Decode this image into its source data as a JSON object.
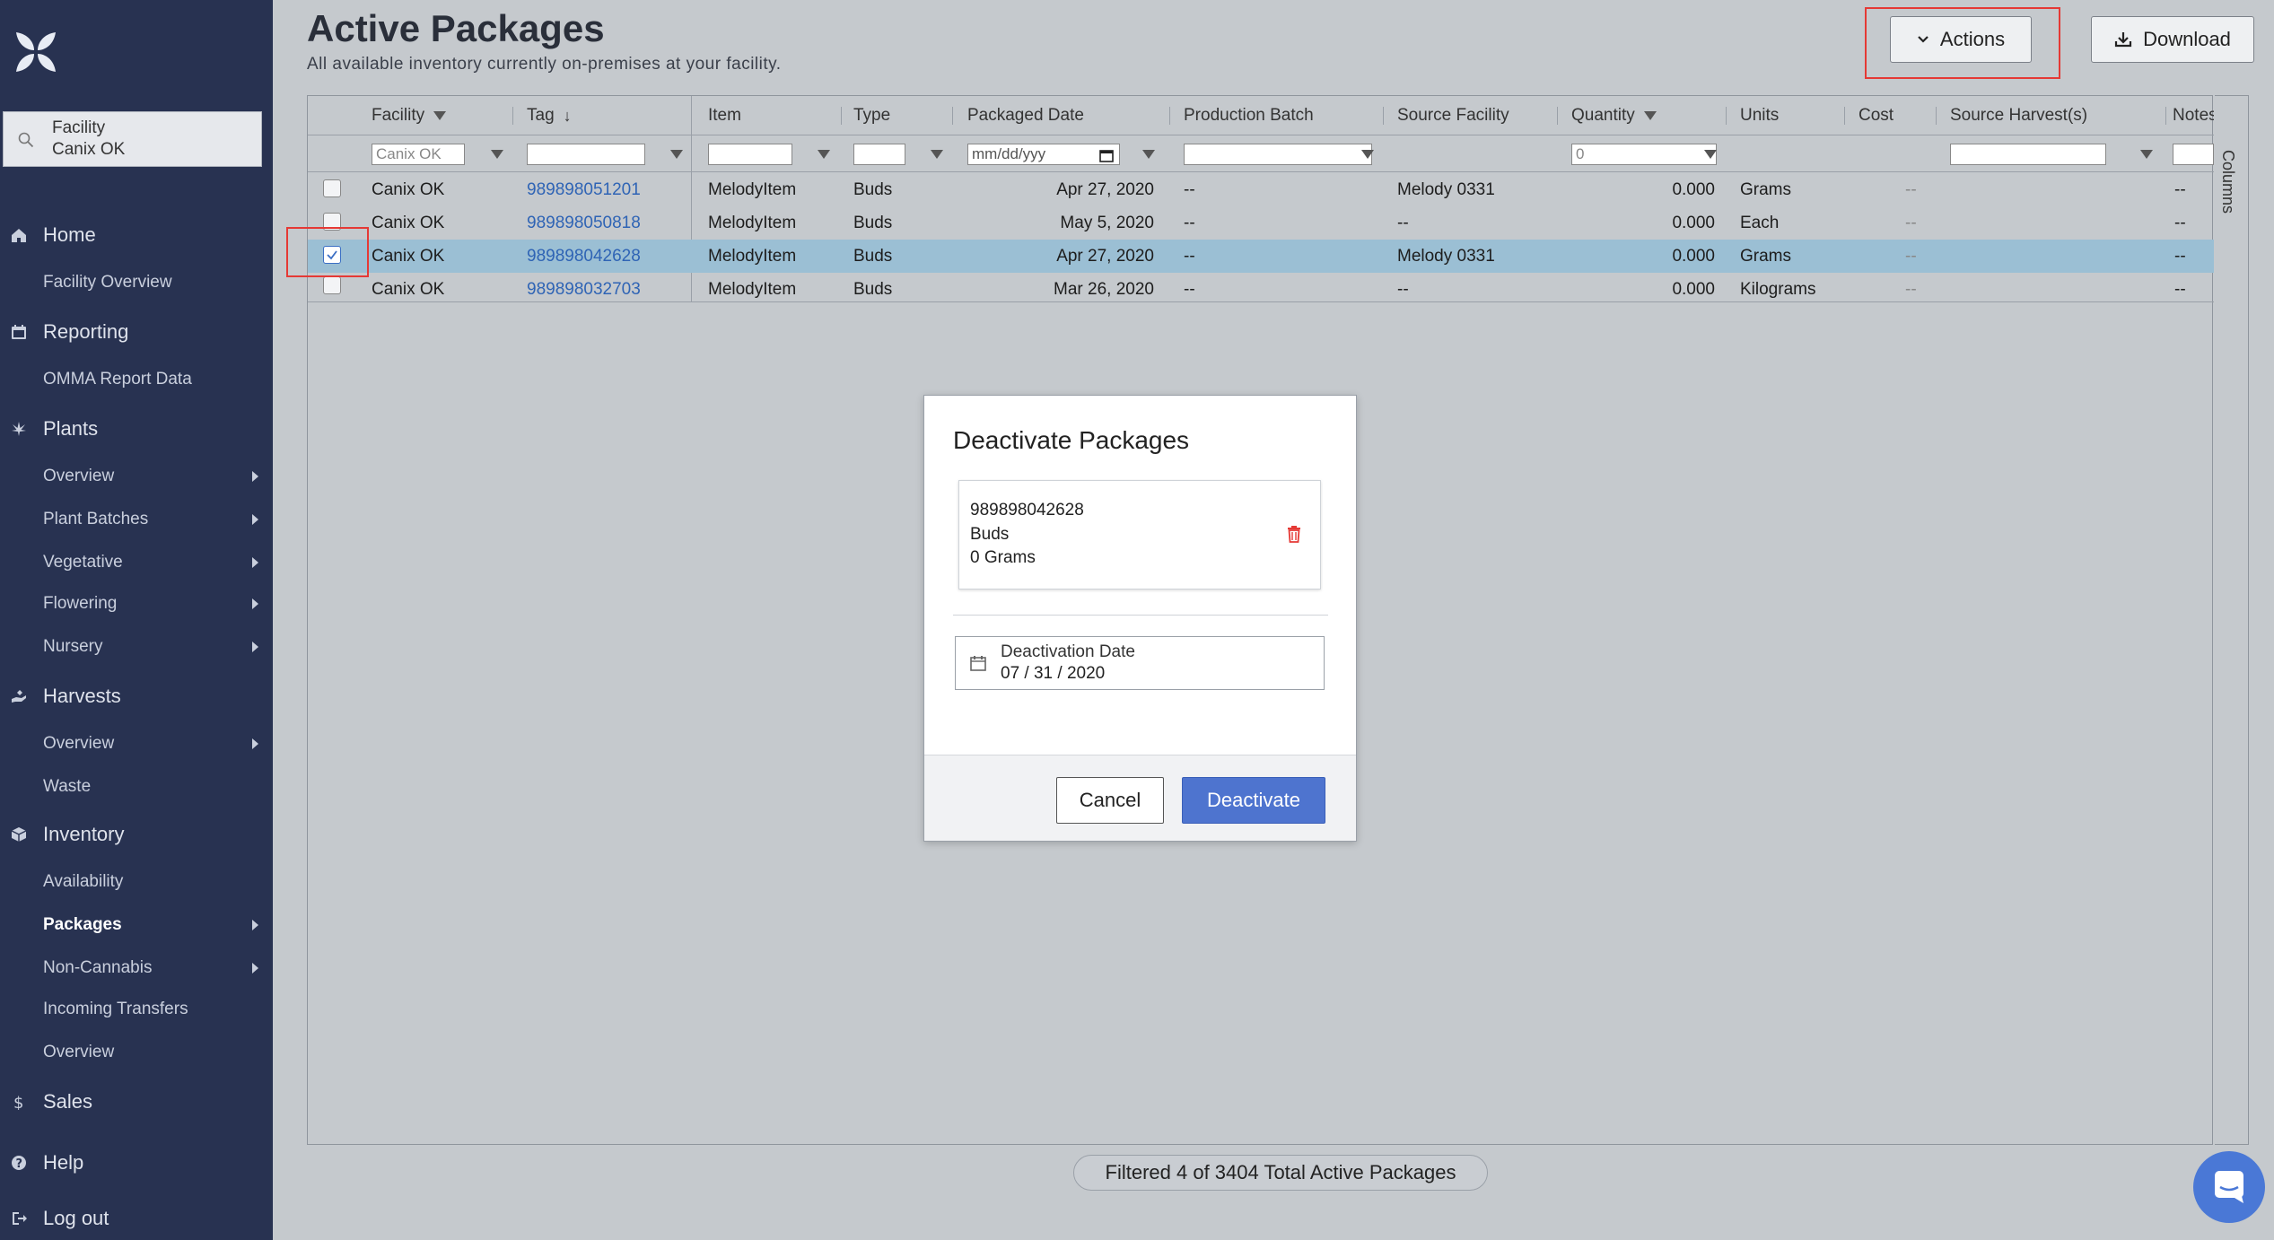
{
  "sidebar": {
    "facility": {
      "label": "Facility",
      "value": "Canix OK"
    },
    "sections": {
      "home": {
        "label": "Home",
        "items": [
          "Facility Overview"
        ]
      },
      "reporting": {
        "label": "Reporting",
        "items": [
          "OMMA Report Data"
        ]
      },
      "plants": {
        "label": "Plants",
        "items": [
          "Overview",
          "Plant Batches",
          "Vegetative",
          "Flowering",
          "Nursery"
        ]
      },
      "harvests": {
        "label": "Harvests",
        "items": [
          "Overview",
          "Waste"
        ]
      },
      "inventory": {
        "label": "Inventory",
        "items": [
          "Availability",
          "Packages",
          "Non-Cannabis",
          "Incoming Transfers",
          "Overview"
        ]
      },
      "sales": {
        "label": "Sales"
      },
      "help": {
        "label": "Help"
      },
      "logout": {
        "label": "Log out"
      }
    }
  },
  "header": {
    "title": "Active Packages",
    "subtitle": "All available inventory currently on-premises at your facility.",
    "actions_label": "Actions",
    "download_label": "Download"
  },
  "table": {
    "columns": [
      "Facility",
      "Tag",
      "Item",
      "Type",
      "Packaged Date",
      "Production Batch",
      "Source Facility",
      "Quantity",
      "Units",
      "Cost",
      "Source Harvest(s)",
      "Notes"
    ],
    "filters": {
      "facility": "Canix OK",
      "packaged_date": "mm/dd/yyy",
      "quantity": "0"
    },
    "rows": [
      {
        "facility": "Canix OK",
        "tag": "989898051201",
        "item": "MelodyItem",
        "type": "Buds",
        "date": "Apr 27, 2020",
        "batch": "--",
        "source": "Melody 0331",
        "qty": "0.000",
        "units": "Grams",
        "cost": "--",
        "notes": "--"
      },
      {
        "facility": "Canix OK",
        "tag": "989898050818",
        "item": "MelodyItem",
        "type": "Buds",
        "date": "May 5, 2020",
        "batch": "--",
        "source": "--",
        "qty": "0.000",
        "units": "Each",
        "cost": "--",
        "notes": "--"
      },
      {
        "facility": "Canix OK",
        "tag": "989898042628",
        "item": "MelodyItem",
        "type": "Buds",
        "date": "Apr 27, 2020",
        "batch": "--",
        "source": "Melody 0331",
        "qty": "0.000",
        "units": "Grams",
        "cost": "--",
        "notes": "--"
      },
      {
        "facility": "Canix OK",
        "tag": "989898032703",
        "item": "MelodyItem",
        "type": "Buds",
        "date": "Mar 26, 2020",
        "batch": "--",
        "source": "--",
        "qty": "0.000",
        "units": "Kilograms",
        "cost": "--",
        "notes": "--"
      }
    ],
    "columns_panel_label": "Columns"
  },
  "footer": {
    "summary": "Filtered 4 of 3404 Total Active Packages"
  },
  "modal": {
    "title": "Deactivate Packages",
    "package": {
      "tag": "989898042628",
      "type": "Buds",
      "qty": "0 Grams"
    },
    "date_label": "Deactivation Date",
    "date_value": "07 / 31 / 2020",
    "cancel_label": "Cancel",
    "deactivate_label": "Deactivate"
  },
  "colors": {
    "sidebar": "#283251",
    "accent": "#4e74cf",
    "selected_row": "#9bbfd4",
    "highlight": "#e53935"
  }
}
